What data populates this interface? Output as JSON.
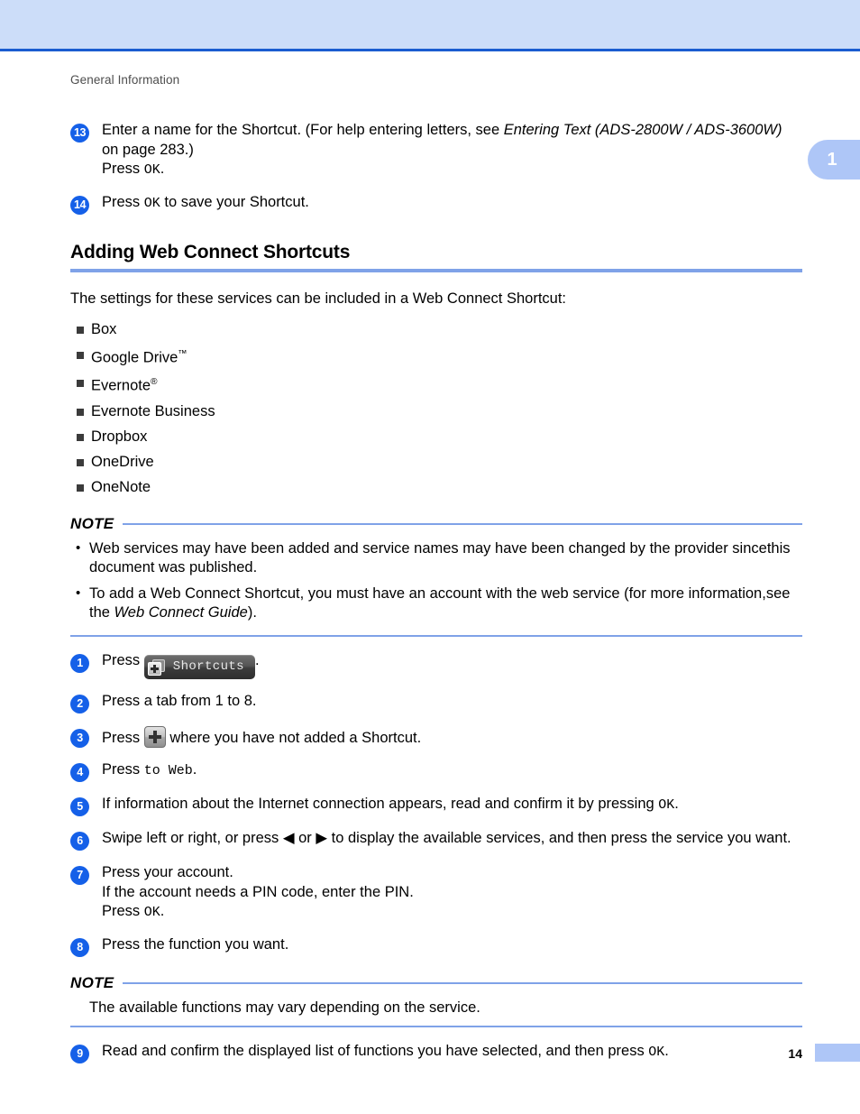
{
  "header": {
    "running_head": "General Information",
    "chapter_tab": "1"
  },
  "steps_top": [
    {
      "num": "13",
      "lines": [
        {
          "parts": [
            {
              "t": "Enter a name for the Shortcut. (For help entering letters, see ",
              "s": "plain"
            },
            {
              "t": "Entering Text (ADS-2800W / ADS-3600W)",
              "s": "italic"
            }
          ]
        },
        {
          "parts": [
            {
              "t": "on page 283.)",
              "s": "plain"
            }
          ]
        },
        {
          "parts": [
            {
              "t": "Press ",
              "s": "plain"
            },
            {
              "t": "OK",
              "s": "mono"
            },
            {
              "t": ".",
              "s": "plain"
            }
          ]
        }
      ]
    },
    {
      "num": "14",
      "lines": [
        {
          "parts": [
            {
              "t": "Press ",
              "s": "plain"
            },
            {
              "t": "OK",
              "s": "mono"
            },
            {
              "t": " to save your Shortcut.",
              "s": "plain"
            }
          ]
        }
      ]
    }
  ],
  "section": {
    "heading": "Adding Web Connect Shortcuts",
    "intro": "The settings for these services can be included in a Web Connect Shortcut:",
    "services": [
      {
        "label": "Box",
        "mark": ""
      },
      {
        "label": "Google Drive",
        "mark": "tm"
      },
      {
        "label": "Evernote",
        "mark": "reg"
      },
      {
        "label": "Evernote Business",
        "mark": ""
      },
      {
        "label": "Dropbox",
        "mark": ""
      },
      {
        "label": "OneDrive",
        "mark": ""
      },
      {
        "label": "OneNote",
        "mark": ""
      }
    ]
  },
  "note_one": {
    "label": "NOTE",
    "bullets": [
      {
        "lines": [
          {
            "parts": [
              {
                "t": "Web services may have been added and service names may have been changed by the provider since",
                "s": "plain"
              }
            ]
          },
          {
            "parts": [
              {
                "t": "this document was published.",
                "s": "plain"
              }
            ]
          }
        ]
      },
      {
        "lines": [
          {
            "parts": [
              {
                "t": "To add a Web Connect Shortcut, you must have an account with the web service (for more information,",
                "s": "plain"
              }
            ]
          },
          {
            "parts": [
              {
                "t": "see the ",
                "s": "plain"
              },
              {
                "t": "Web Connect Guide",
                "s": "italic"
              },
              {
                "t": ").",
                "s": "plain"
              }
            ]
          }
        ]
      }
    ]
  },
  "steps_main": [
    {
      "num": "1",
      "lines": [
        {
          "parts": [
            {
              "t": "Press ",
              "s": "plain"
            },
            {
              "t": "shortcuts-button",
              "s": "icon-shortcuts",
              "label": "Shortcuts"
            },
            {
              "t": ".",
              "s": "plain"
            }
          ]
        }
      ]
    },
    {
      "num": "2",
      "lines": [
        {
          "parts": [
            {
              "t": "Press a tab from 1 to 8.",
              "s": "plain"
            }
          ]
        }
      ]
    },
    {
      "num": "3",
      "lines": [
        {
          "parts": [
            {
              "t": "Press ",
              "s": "plain"
            },
            {
              "t": "plus-button",
              "s": "icon-plus"
            },
            {
              "t": " where you have not added a Shortcut.",
              "s": "plain"
            }
          ]
        }
      ]
    },
    {
      "num": "4",
      "lines": [
        {
          "parts": [
            {
              "t": "Press ",
              "s": "plain"
            },
            {
              "t": "to Web",
              "s": "mono"
            },
            {
              "t": ".",
              "s": "plain"
            }
          ]
        }
      ]
    },
    {
      "num": "5",
      "lines": [
        {
          "parts": [
            {
              "t": "If information about the Internet connection appears, read and confirm it by pressing ",
              "s": "plain"
            },
            {
              "t": "OK",
              "s": "mono"
            },
            {
              "t": ".",
              "s": "plain"
            }
          ]
        }
      ]
    },
    {
      "num": "6",
      "lines": [
        {
          "parts": [
            {
              "t": "Swipe left or right, or press ",
              "s": "plain"
            },
            {
              "t": "◀",
              "s": "glyph"
            },
            {
              "t": " or ",
              "s": "plain"
            },
            {
              "t": "▶",
              "s": "glyph"
            },
            {
              "t": " to display the available services, and then press the service you want.",
              "s": "plain"
            }
          ]
        }
      ]
    },
    {
      "num": "7",
      "lines": [
        {
          "parts": [
            {
              "t": "Press your account.",
              "s": "plain"
            }
          ]
        },
        {
          "parts": [
            {
              "t": "If the account needs a PIN code, enter the PIN.",
              "s": "plain"
            }
          ]
        },
        {
          "parts": [
            {
              "t": "Press ",
              "s": "plain"
            },
            {
              "t": "OK",
              "s": "mono"
            },
            {
              "t": ".",
              "s": "plain"
            }
          ]
        }
      ]
    },
    {
      "num": "8",
      "lines": [
        {
          "parts": [
            {
              "t": "Press the function you want.",
              "s": "plain"
            }
          ]
        }
      ]
    }
  ],
  "note_two": {
    "label": "NOTE",
    "text": "The available functions may vary depending on the service."
  },
  "steps_tail": [
    {
      "num": "9",
      "lines": [
        {
          "parts": [
            {
              "t": "Read and confirm the displayed list of functions you have selected, and then press ",
              "s": "plain"
            },
            {
              "t": "OK",
              "s": "mono"
            },
            {
              "t": ".",
              "s": "plain"
            }
          ]
        }
      ]
    }
  ],
  "footer": {
    "page_number": "14"
  },
  "colors": {
    "band": "#ccddf9",
    "band_border": "#1a5cd0",
    "accent_rule": "#7fa2e8",
    "step_circle": "#1560e8",
    "tab": "#aec6f7",
    "bullet": "#3b3b3b"
  }
}
